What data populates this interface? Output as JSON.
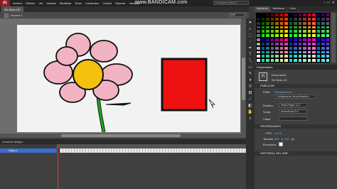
{
  "app": {
    "logo": "Fl"
  },
  "menu": [
    "Archivo",
    "Edición",
    "Ver",
    "Insertar",
    "Modificar",
    "Texto",
    "Comandos",
    "Control",
    "Depurar",
    "Ventana"
  ],
  "watermark": "www.BANDICAM.com",
  "search_placeholder": "Conceptos básicos",
  "window_controls": {
    "min": "–",
    "max": "□",
    "close": "✕"
  },
  "doc_tab": "Sin título-13*",
  "edit_bar": {
    "scene": "Escena 1",
    "zoom": "64%"
  },
  "timeline": {
    "title": "Línea de tiempo",
    "layer": "Capa 1"
  },
  "panels": {
    "tabs": [
      "Muestras",
      "Biblioteca",
      "Color"
    ],
    "props_tab": "Propiedades",
    "doc_label": "Documento",
    "doc_name": "Sin título-13",
    "publish_section": "PUBLICAR",
    "perfil_label": "Perfil:",
    "perfil_value": "Predetermina...",
    "config_button": "Configuración de publicación...",
    "destino_label": "Destino:",
    "destino_value": "Flash Player 11.2",
    "script_label": "Script:",
    "script_value": "ActionScript 3.0",
    "clase_label": "Clase:",
    "props_section": "PROPIEDADES",
    "fps_label": "FPS:",
    "fps_value": "24.00",
    "tamano_label": "Tamaño:",
    "tamano_w": "550",
    "tamano_sep": "x",
    "tamano_h": "400",
    "tamano_unit": "px",
    "escenario_label": "Escenario:",
    "history_section": "HISTORIAL DEL SWF"
  },
  "colors": {
    "flower_petal": "#f2b3c2",
    "flower_center": "#f2c20f",
    "stem": "#1ea51e",
    "rectangle": "#ee1111",
    "stage": "#f2f2f2"
  },
  "toolbar_icons": [
    "selection-icon",
    "subselection-icon",
    "free-transform-icon",
    "lasso-icon",
    "pen-icon",
    "text-icon",
    "line-icon",
    "rectangle-icon",
    "pencil-icon",
    "brush-icon",
    "bone-icon",
    "paint-bucket-icon",
    "eyedropper-icon",
    "eraser-icon",
    "hand-icon",
    "zoom-icon"
  ]
}
